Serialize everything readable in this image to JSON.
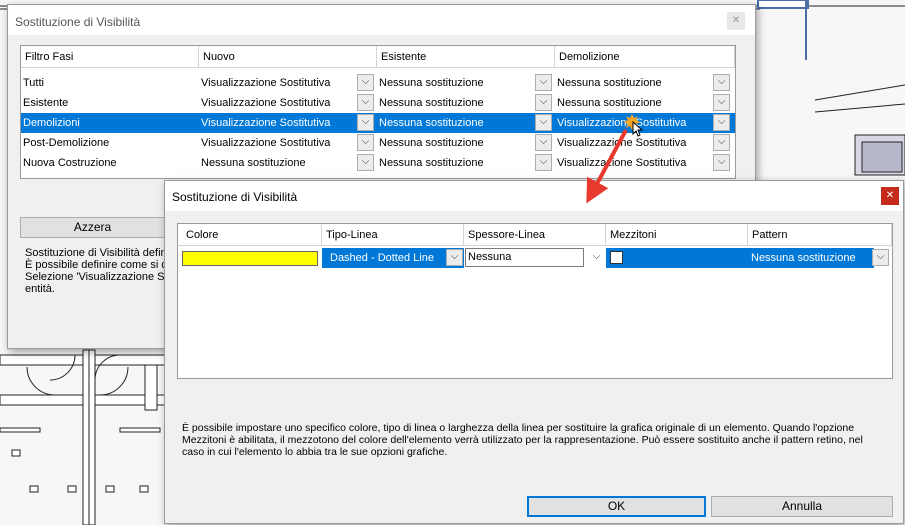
{
  "dialog1": {
    "title": "Sostituzione di Visibilità",
    "close_glyph": "✕",
    "columns": [
      "Filtro Fasi",
      "Nuovo",
      "Esistente",
      "Demolizione"
    ],
    "rows": [
      [
        "Tutti",
        "Visualizzazione Sostitutiva",
        "Nessuna sostituzione",
        "Nessuna sostituzione"
      ],
      [
        "Esistente",
        "Visualizzazione Sostitutiva",
        "Nessuna sostituzione",
        "Nessuna sostituzione"
      ],
      [
        "Demolizioni",
        "Visualizzazione Sostitutiva",
        "Nessuna sostituzione",
        "Visualizzazione Sostitutiva"
      ],
      [
        "Post-Demolizione",
        "Visualizzazione Sostitutiva",
        "Nessuna sostituzione",
        "Visualizzazione Sostitutiva"
      ],
      [
        "Nuova Costruzione",
        "Nessuna sostituzione",
        "Nessuna sostituzione",
        "Visualizzazione Sostitutiva"
      ]
    ],
    "selected_row": 2,
    "reset_label": "Azzera",
    "description_lines": [
      "Sostituzione di Visibilità definis",
      "È possibile definire come si de",
      "Selezione 'Visualizzazione Sost",
      "entità."
    ]
  },
  "dialog2": {
    "title": "Sostituzione di Visibilità",
    "close_glyph": "✕",
    "columns": [
      "Colore",
      "Tipo-Linea",
      "Spessore-Linea",
      "Mezzitoni",
      "Pattern"
    ],
    "row": {
      "colore": "#ffff00",
      "tipo_linea": "Dashed - Dotted Line",
      "spessore_linea": "Nessuna",
      "mezzitoni_checked": false,
      "pattern": "Nessuna sostituzione"
    },
    "description_lines": [
      "È possibile impostare uno specifico colore, tipo di linea o larghezza della linea per sostituire la grafica originale di un elemento. Quando l'opzione",
      "Mezzitoni è abilitata, il mezzotono del colore dell'elemento verrà utilizzato per la rappresentazione. Può essere sostituito anche il pattern retino, nel",
      "caso in cui l'elemento lo abbia tra le sue opzioni grafiche."
    ],
    "ok_label": "OK",
    "cancel_label": "Annulla"
  },
  "icons": {
    "dropdown": "chevron-down-icon",
    "close": "close-icon",
    "cursor": "mouse-pointer-icon",
    "arrow": "red-arrow-annotation-icon"
  },
  "colors": {
    "selection": "#0078d7",
    "annotation_arrow": "#e8392f",
    "close_button": "#c42b1c"
  }
}
